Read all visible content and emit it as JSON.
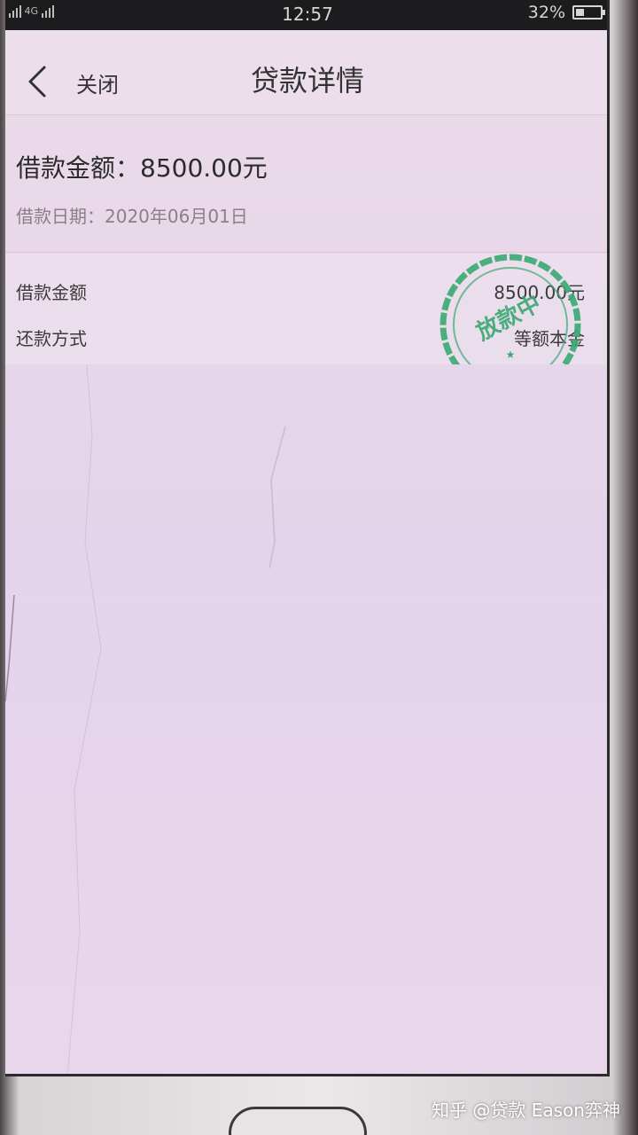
{
  "status_bar": {
    "signal_text": "4G",
    "time": "12:57",
    "battery": "32%"
  },
  "nav": {
    "close_label": "关闭",
    "title": "贷款详情"
  },
  "summary": {
    "amount_text": "借款金额：8500.00元",
    "date_text": "借款日期：2020年06月01日"
  },
  "details": [
    {
      "label": "借款金额",
      "value": "8500.00元"
    },
    {
      "label": "还款方式",
      "value": "等额本金"
    }
  ],
  "stamp": {
    "text": "放款中",
    "color": "#3aa873"
  },
  "watermark": "知乎 @贷款 Eason弈神",
  "icons": [
    "signal-icon",
    "battery-icon",
    "back-chevron-icon"
  ]
}
